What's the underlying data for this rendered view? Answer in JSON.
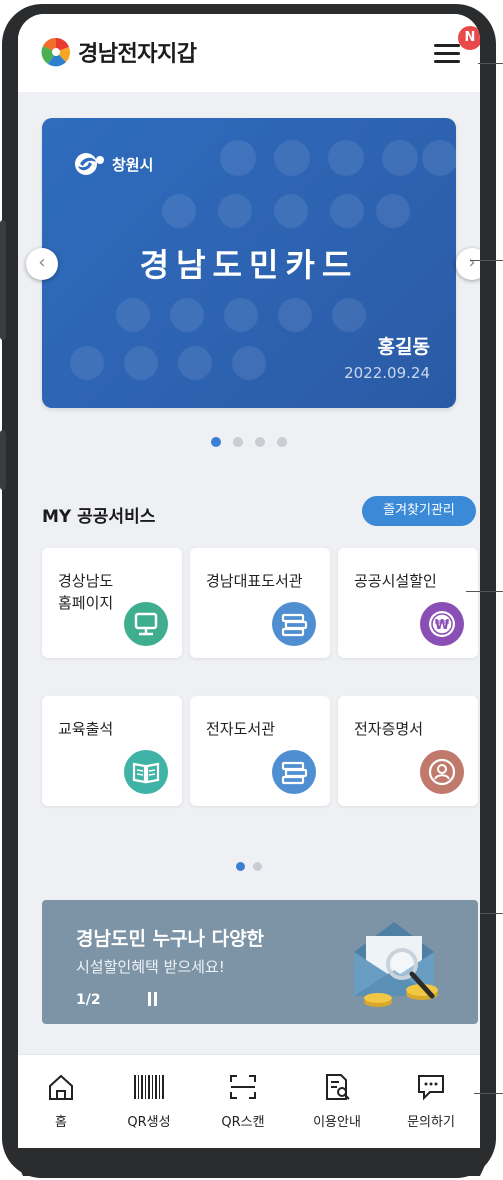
{
  "header": {
    "app_title": "경남전자지갑",
    "notification_badge": "N"
  },
  "card": {
    "city_name": "창원시",
    "title": "경남도민카드",
    "holder_name": "홍길동",
    "date": "2022.09.24",
    "pagination": {
      "total": 4,
      "active": 1
    }
  },
  "services": {
    "section_title": "MY 공공서비스",
    "favorites_button": "즐겨찾기관리",
    "tiles": [
      {
        "label": "경상남도\n홈페이지",
        "icon": "monitor-icon",
        "color": "#3fae8e"
      },
      {
        "label": "경남대표도서관",
        "icon": "books-icon",
        "color": "#4f8ed0"
      },
      {
        "label": "공공시설할인",
        "icon": "won-coin-icon",
        "color": "#8a4fb5"
      },
      {
        "label": "교육출석",
        "icon": "open-book-icon",
        "color": "#3fb3a5"
      },
      {
        "label": "전자도서관",
        "icon": "books-icon",
        "color": "#4f8ed0"
      },
      {
        "label": "전자증명서",
        "icon": "person-badge-icon",
        "color": "#c0796a"
      }
    ],
    "pagination": {
      "total": 2,
      "active": 1
    }
  },
  "banner": {
    "title": "경남도민 누구나 다양한",
    "subtitle": "시설할인혜택 받으세요!",
    "page_indicator": "1/2"
  },
  "bottom_nav": {
    "items": [
      {
        "label": "홈",
        "icon": "home-icon"
      },
      {
        "label": "QR생성",
        "icon": "barcode-icon"
      },
      {
        "label": "QR스캔",
        "icon": "scan-icon"
      },
      {
        "label": "이용안내",
        "icon": "guide-document-icon"
      },
      {
        "label": "문의하기",
        "icon": "chat-bubble-icon"
      }
    ]
  },
  "colors": {
    "card_blue": "#2f6cbd",
    "accent_blue": "#3a8ad8",
    "badge_red": "#e84a4a",
    "banner_gray": "#7d94a6"
  }
}
